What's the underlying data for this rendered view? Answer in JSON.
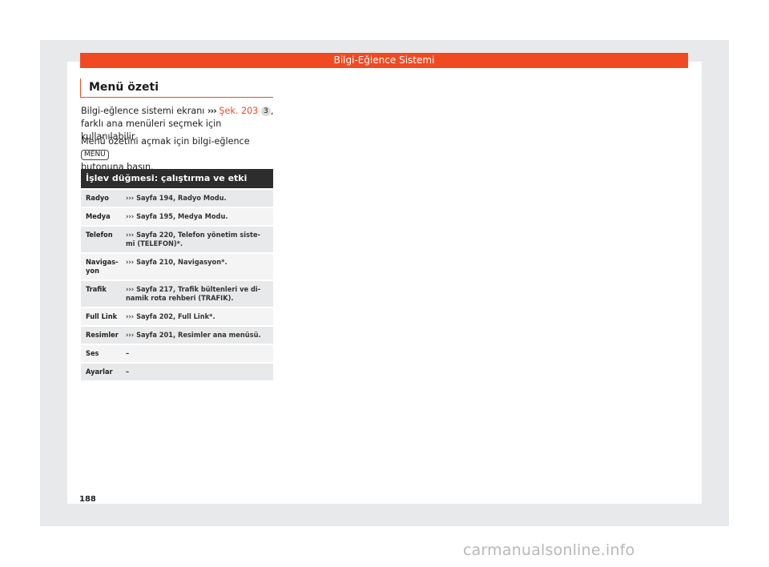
{
  "header": {
    "title": "Bilgi-Eğlence Sistemi"
  },
  "section": {
    "title": "Menü özeti"
  },
  "para1": {
    "text_a": "Bilgi-eğlence sistemi ekranı ",
    "arrows": "›››",
    "ref": "Şek. 203",
    "ref_num": "3",
    "text_b": ",",
    "text_c": "farklı ana menüleri seçmek için kullanılabilir."
  },
  "para2": {
    "text_a": "Menü özetini açmak için bilgi-eğlence ",
    "key": "MENU",
    "text_b": "butonuna basın."
  },
  "table": {
    "heading": "İşlev düğmesi: çalıştırma ve etki",
    "rows": [
      {
        "name": "Radyo",
        "desc": "››› Sayfa 194, Radyo Modu."
      },
      {
        "name": "Medya",
        "desc": "››› Sayfa 195, Medya Modu."
      },
      {
        "name": "Telefon",
        "desc": "››› Sayfa 220, Telefon yönetim siste-mi (TELEFON)*."
      },
      {
        "name": "Navigas-yon",
        "desc": "››› Sayfa 210, Navigasyon*."
      },
      {
        "name": "Trafik",
        "desc": "››› Sayfa 217, Trafik bültenleri ve di-namik rota rehberi (TRAFIK)."
      },
      {
        "name": "Full Link",
        "desc": "››› Sayfa 202, Full Link*."
      },
      {
        "name": "Resimler",
        "desc": "››› Sayfa 201, Resimler ana menüsü."
      },
      {
        "name": "Ses",
        "desc": "–"
      },
      {
        "name": "Ayarlar",
        "desc": "–"
      }
    ]
  },
  "page_number": "188",
  "watermark": "carmanualsonline.info",
  "colors": {
    "accent": "#f04a23",
    "table_header": "#2d2d2d",
    "page_bg": "#e8e9ea"
  }
}
